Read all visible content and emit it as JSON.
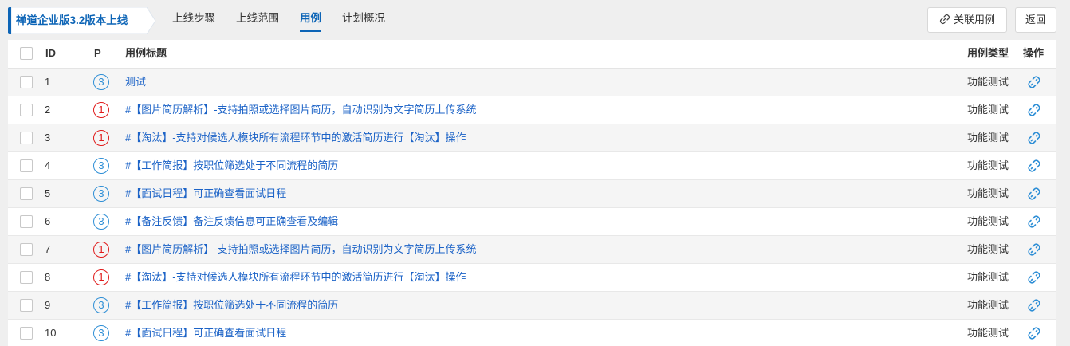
{
  "header": {
    "title": "禅道企业版3.2版本上线",
    "tabs": [
      {
        "label": "上线步骤",
        "active": false
      },
      {
        "label": "上线范围",
        "active": false
      },
      {
        "label": "用例",
        "active": true
      },
      {
        "label": "计划概况",
        "active": false
      }
    ],
    "link_case_label": "关联用例",
    "back_label": "返回"
  },
  "table": {
    "columns": {
      "id": "ID",
      "priority": "P",
      "title": "用例标题",
      "type": "用例类型",
      "action": "操作"
    },
    "rows": [
      {
        "id": "1",
        "priority": "3",
        "title": "测试",
        "type": "功能测试"
      },
      {
        "id": "2",
        "priority": "1",
        "title": "#【图片简历解析】-支持拍照或选择图片简历，自动识别为文字简历上传系统",
        "type": "功能测试"
      },
      {
        "id": "3",
        "priority": "1",
        "title": "#【淘汰】-支持对候选人模块所有流程环节中的激活简历进行【淘汰】操作",
        "type": "功能测试"
      },
      {
        "id": "4",
        "priority": "3",
        "title": "#【工作简报】按职位筛选处于不同流程的简历",
        "type": "功能测试"
      },
      {
        "id": "5",
        "priority": "3",
        "title": "#【面试日程】可正确查看面试日程",
        "type": "功能测试"
      },
      {
        "id": "6",
        "priority": "3",
        "title": "#【备注反馈】备注反馈信息可正确查看及编辑",
        "type": "功能测试"
      },
      {
        "id": "7",
        "priority": "1",
        "title": "#【图片简历解析】-支持拍照或选择图片简历，自动识别为文字简历上传系统",
        "type": "功能测试"
      },
      {
        "id": "8",
        "priority": "1",
        "title": "#【淘汰】-支持对候选人模块所有流程环节中的激活简历进行【淘汰】操作",
        "type": "功能测试"
      },
      {
        "id": "9",
        "priority": "3",
        "title": "#【工作简报】按职位筛选处于不同流程的简历",
        "type": "功能测试"
      },
      {
        "id": "10",
        "priority": "3",
        "title": "#【面试日程】可正确查看面试日程",
        "type": "功能测试"
      }
    ]
  },
  "colors": {
    "accent": "#0c64b6",
    "link": "#1c63c7",
    "priority_high": "#e01b1b",
    "priority_low": "#2f8fd6"
  },
  "icons": {
    "link_button": "link-icon",
    "row_action": "unlink-icon"
  }
}
